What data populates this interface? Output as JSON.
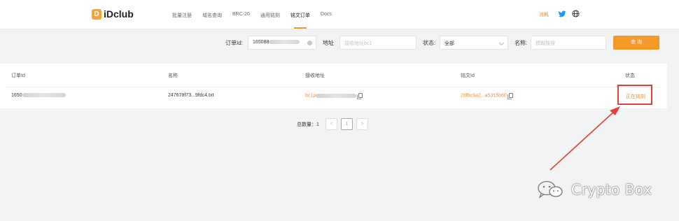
{
  "header": {
    "logo_mark": "D",
    "logo_text": "iDclub",
    "nav": [
      "批量注册",
      "域名查询",
      "BRC-20",
      "通用铭刻",
      "铭文订单",
      "Docs"
    ],
    "active_index": 4,
    "lang": "消耗"
  },
  "filters": {
    "order_id_label": "订单Id:",
    "order_id_value": "165088",
    "address_label": "地址",
    "address_placeholder": "接收地址bc1",
    "status_label": "状态:",
    "status_value": "全部",
    "name_label": "名称:",
    "name_placeholder": "模糊搜搜",
    "query_button": "查 询"
  },
  "table": {
    "headers": [
      "订单Id",
      "名称",
      "接收地址",
      "铭文Id",
      "状态"
    ],
    "rows": [
      {
        "order_id": "1650",
        "name": "247678f73...9fdc4.txt",
        "address": "bc1p",
        "inscription_id": "28fbc9a2...a5315b60",
        "status": "正在铭刻"
      }
    ]
  },
  "pagination": {
    "total_label": "总数量：1",
    "prev": "<",
    "current": "1",
    "next": ">"
  },
  "watermark": {
    "text": "Crypto Box"
  },
  "colors": {
    "accent": "#f39a2a",
    "annotation_red": "#e0413a"
  }
}
